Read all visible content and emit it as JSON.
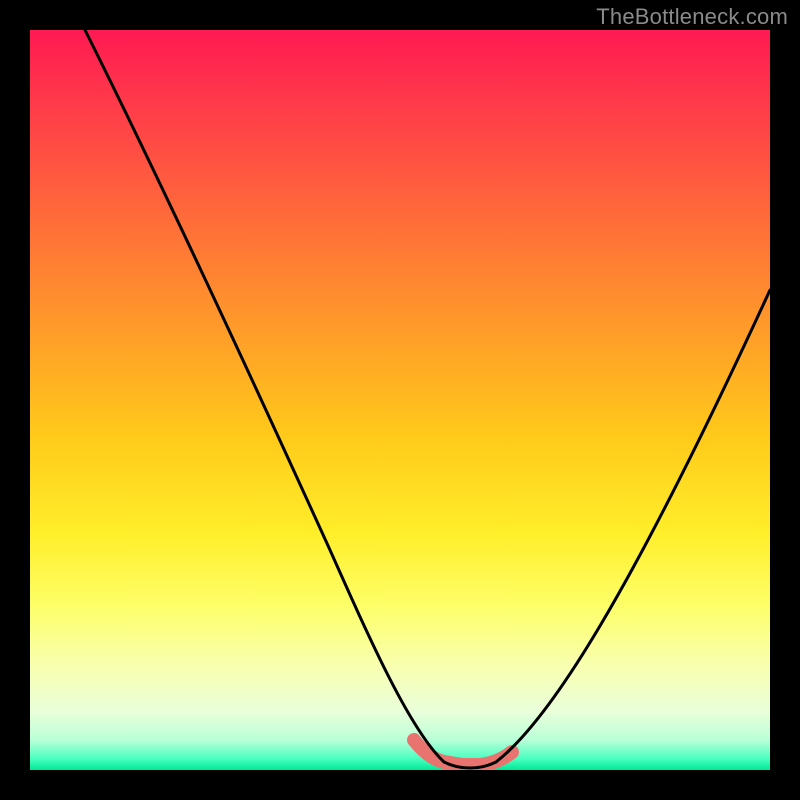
{
  "watermark": "TheBottleneck.com",
  "chart_data": {
    "type": "line",
    "title": "",
    "xlabel": "",
    "ylabel": "",
    "xlim": [
      0,
      100
    ],
    "ylim": [
      0,
      100
    ],
    "x": [
      0,
      5,
      10,
      15,
      20,
      25,
      30,
      35,
      40,
      45,
      50,
      52,
      55,
      58,
      60,
      63,
      65,
      70,
      75,
      80,
      85,
      90,
      95,
      100
    ],
    "values": [
      100,
      92,
      83,
      74,
      65,
      56,
      47,
      38,
      29,
      20,
      11,
      8,
      4,
      2,
      1,
      1,
      2,
      6,
      13,
      22,
      32,
      42,
      53,
      65
    ],
    "highlight_band": {
      "x_start": 52,
      "x_end": 65,
      "color": "#e8736f"
    },
    "background_gradient": [
      "#ff1a52",
      "#ffca1a",
      "#fdff6a",
      "#00e898"
    ],
    "grid": false
  }
}
